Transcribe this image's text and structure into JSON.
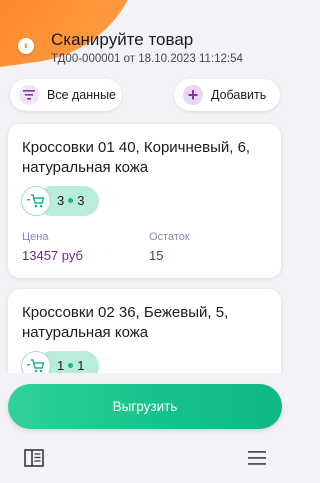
{
  "header": {
    "title": "Сканируйте товар",
    "subtitle": "ТД00-000001 от 18.10.2023 11:12:54",
    "back_icon": "chevron-left-icon",
    "accent_color": "#ff8a2a"
  },
  "toolbar": {
    "all_data_label": "Все данные",
    "all_data_icon": "filter-icon",
    "add_label": "Добавить",
    "add_icon": "plus-icon"
  },
  "items": [
    {
      "name": "Кроссовки 01 40, Коричневый, 6, натуральная кожа",
      "qty_scanned": "3",
      "qty_planned": "3",
      "price_label": "Цена",
      "price": "13457 руб",
      "stock_label": "Остаток",
      "stock": "15"
    },
    {
      "name": "Кроссовки 02 36, Бежевый, 5, натуральная кожа",
      "qty_scanned": "1",
      "qty_planned": "1"
    }
  ],
  "footer": {
    "upload_label": "Выгрузить",
    "upload_color": "#19c38c",
    "left_icon": "sidebar-panel-icon",
    "right_icon": "hamburger-menu-icon"
  }
}
